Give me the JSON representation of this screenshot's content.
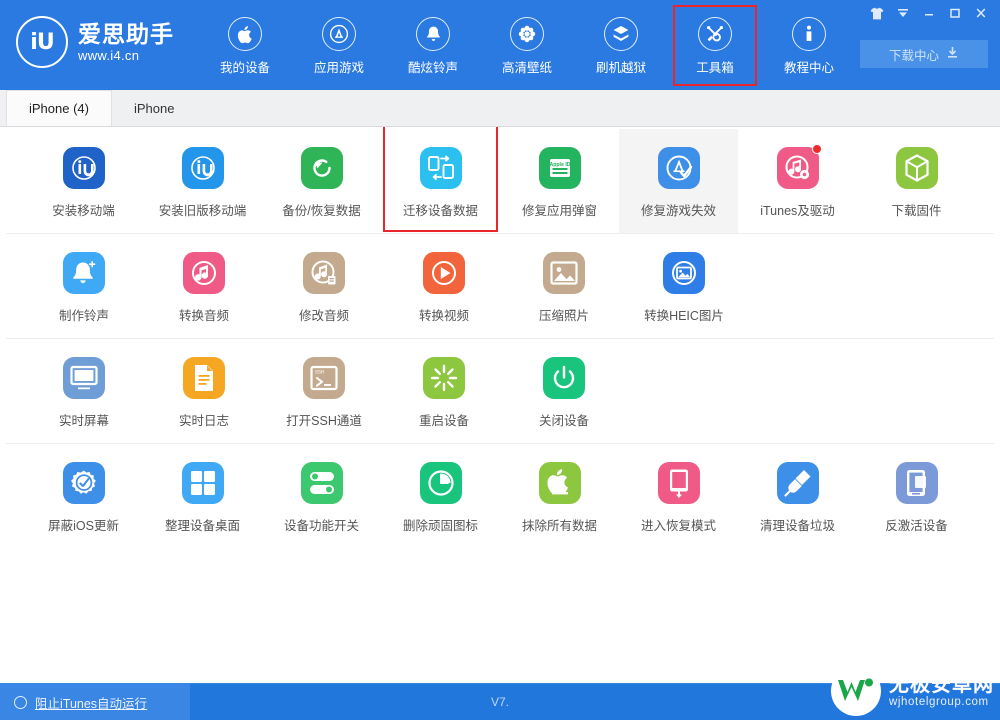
{
  "window": {
    "controls": [
      {
        "name": "skin-icon",
        "glyph": "shirt",
        "title": "皮肤"
      },
      {
        "name": "menu-dropdown-icon",
        "glyph": "caret",
        "title": "菜单"
      },
      {
        "name": "minimize-button",
        "glyph": "minimize",
        "title": "最小化"
      },
      {
        "name": "maximize-button",
        "glyph": "maximize",
        "title": "最大化"
      },
      {
        "name": "close-button",
        "glyph": "close",
        "title": "关闭"
      }
    ]
  },
  "brand": {
    "logo_text": "iU",
    "name": "爱思助手",
    "url": "www.i4.cn"
  },
  "nav": {
    "items": [
      {
        "label": "我的设备",
        "icon": "apple-icon",
        "selected": false
      },
      {
        "label": "应用游戏",
        "icon": "appstore-icon",
        "selected": false
      },
      {
        "label": "酷炫铃声",
        "icon": "bell-icon",
        "selected": false
      },
      {
        "label": "高清壁纸",
        "icon": "flower-icon",
        "selected": false
      },
      {
        "label": "刷机越狱",
        "icon": "box-icon",
        "selected": false
      },
      {
        "label": "工具箱",
        "icon": "tools-icon",
        "selected": true
      },
      {
        "label": "教程中心",
        "icon": "info-icon",
        "selected": false
      }
    ]
  },
  "download_center": {
    "label": "下载中心",
    "icon": "download-icon"
  },
  "tabs": [
    {
      "label": "iPhone (4)",
      "active": true
    },
    {
      "label": "iPhone",
      "active": false
    }
  ],
  "accent_color": "#2a7ae2",
  "highlight_color": "#e8262b",
  "tool_rows": [
    [
      {
        "label": "安装移动端",
        "icon": "i4-install-icon",
        "bg": "#1f63c8",
        "glyph": "iU",
        "state": "normal"
      },
      {
        "label": "安装旧版移动端",
        "icon": "i4-install-old-icon",
        "bg": "#2396ec",
        "glyph": "iU",
        "state": "normal"
      },
      {
        "label": "备份/恢复数据",
        "icon": "backup-restore-icon",
        "bg": "#2fb457",
        "glyph": "restore",
        "state": "normal"
      },
      {
        "label": "迁移设备数据",
        "icon": "migrate-data-icon",
        "bg": "#2bc0f0",
        "glyph": "migrate",
        "state": "selected"
      },
      {
        "label": "修复应用弹窗",
        "icon": "fix-appleid-popup-icon",
        "bg": "#24b35e",
        "glyph": "appleid",
        "state": "normal"
      },
      {
        "label": "修复游戏失效",
        "icon": "fix-game-icon",
        "bg": "#3d8fe8",
        "glyph": "appstore-check",
        "state": "hover"
      },
      {
        "label": "iTunes及驱动",
        "icon": "itunes-driver-icon",
        "bg": "#ef5b86",
        "glyph": "itunes",
        "state": "normal",
        "badge": true
      },
      {
        "label": "下载固件",
        "icon": "download-firmware-icon",
        "bg": "#8dc63f",
        "glyph": "cube",
        "state": "normal"
      }
    ],
    [
      {
        "label": "制作铃声",
        "icon": "make-ringtone-icon",
        "bg": "#3fa9f5",
        "glyph": "bell-plus",
        "state": "normal"
      },
      {
        "label": "转换音频",
        "icon": "convert-audio-icon",
        "bg": "#ef5b86",
        "glyph": "note-circle",
        "state": "normal"
      },
      {
        "label": "修改音频",
        "icon": "edit-audio-icon",
        "bg": "#c3a98e",
        "glyph": "note-tag",
        "state": "normal"
      },
      {
        "label": "转换视频",
        "icon": "convert-video-icon",
        "bg": "#f2643c",
        "glyph": "play-circle",
        "state": "normal"
      },
      {
        "label": "压缩照片",
        "icon": "compress-photo-icon",
        "bg": "#c3a98e",
        "glyph": "photo",
        "state": "normal"
      },
      {
        "label": "转换HEIC图片",
        "icon": "convert-heic-icon",
        "bg": "#2f7ee8",
        "glyph": "photo-circle",
        "state": "normal"
      }
    ],
    [
      {
        "label": "实时屏幕",
        "icon": "live-screen-icon",
        "bg": "#6f9ed6",
        "glyph": "monitor",
        "state": "normal"
      },
      {
        "label": "实时日志",
        "icon": "live-log-icon",
        "bg": "#f5a623",
        "glyph": "doc",
        "state": "normal"
      },
      {
        "label": "打开SSH通道",
        "icon": "open-ssh-icon",
        "bg": "#c3a98e",
        "glyph": "terminal",
        "state": "normal"
      },
      {
        "label": "重启设备",
        "icon": "reboot-device-icon",
        "bg": "#8dc63f",
        "glyph": "spinner",
        "state": "normal"
      },
      {
        "label": "关闭设备",
        "icon": "shutdown-device-icon",
        "bg": "#19c47d",
        "glyph": "power",
        "state": "normal"
      }
    ],
    [
      {
        "label": "屏蔽iOS更新",
        "icon": "block-ios-update-icon",
        "bg": "#3d8fe8",
        "glyph": "gear-check",
        "state": "normal"
      },
      {
        "label": "整理设备桌面",
        "icon": "organize-desktop-icon",
        "bg": "#3fa9f5",
        "glyph": "grid",
        "state": "normal"
      },
      {
        "label": "设备功能开关",
        "icon": "device-toggles-icon",
        "bg": "#3cc86e",
        "glyph": "toggles",
        "state": "normal"
      },
      {
        "label": "删除顽固图标",
        "icon": "delete-stubborn-icon",
        "bg": "#19c47d",
        "glyph": "clock-pie",
        "state": "normal"
      },
      {
        "label": "抹除所有数据",
        "icon": "erase-all-data-icon",
        "bg": "#8dc63f",
        "glyph": "apple-erase",
        "state": "normal"
      },
      {
        "label": "进入恢复模式",
        "icon": "enter-recovery-icon",
        "bg": "#ef5b86",
        "glyph": "phone-plug",
        "state": "normal"
      },
      {
        "label": "清理设备垃圾",
        "icon": "clean-junk-icon",
        "bg": "#3d8fe8",
        "glyph": "broom",
        "state": "normal"
      },
      {
        "label": "反激活设备",
        "icon": "deactivate-device-icon",
        "bg": "#7d9ad8",
        "glyph": "phone-card",
        "state": "normal"
      }
    ]
  ],
  "statusbar": {
    "block_itunes_label": "阻止iTunes自动运行",
    "version": "V7."
  },
  "watermark": {
    "title": "无极安卓网",
    "subtitle": "wjhotelgroup.com"
  }
}
